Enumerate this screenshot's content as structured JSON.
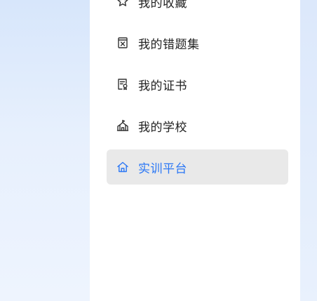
{
  "menu": {
    "items": [
      {
        "label": "我的收藏",
        "icon": "star-icon"
      },
      {
        "label": "我的错题集",
        "icon": "error-book-icon"
      },
      {
        "label": "我的证书",
        "icon": "certificate-icon"
      },
      {
        "label": "我的学校",
        "icon": "school-icon"
      },
      {
        "label": "实训平台",
        "icon": "home-icon",
        "active": true
      }
    ]
  },
  "colors": {
    "accent": "#2c78f5",
    "active_bg": "#e9e9e9",
    "text": "#222222",
    "panel_bg": "#ffffff"
  }
}
